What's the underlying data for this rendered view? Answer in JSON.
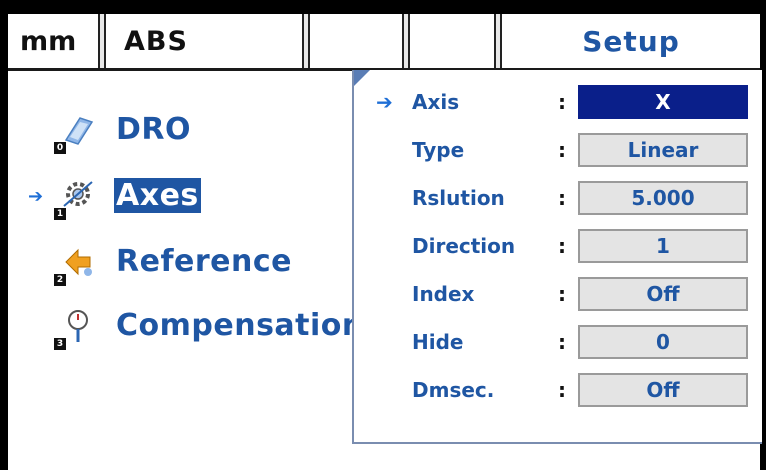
{
  "status_bar": {
    "unit": "mm",
    "mode": "ABS",
    "title": "Setup"
  },
  "menu": {
    "items": [
      {
        "number": "0",
        "label": "DRO",
        "icon": "dro-icon",
        "selected": false
      },
      {
        "number": "1",
        "label": "Axes",
        "icon": "axes-gear-icon",
        "selected": true
      },
      {
        "number": "2",
        "label": "Reference",
        "icon": "reference-icon",
        "selected": false
      },
      {
        "number": "3",
        "label": "Compensation",
        "icon": "compensation-icon",
        "selected": false
      }
    ]
  },
  "settings": {
    "colon": ":",
    "rows": [
      {
        "label": "Axis",
        "value": "X",
        "active": true
      },
      {
        "label": "Type",
        "value": "Linear",
        "active": false
      },
      {
        "label": "Rslution",
        "value": "5.000",
        "active": false
      },
      {
        "label": "Direction",
        "value": "1",
        "active": false
      },
      {
        "label": "Index",
        "value": "Off",
        "active": false
      },
      {
        "label": "Hide",
        "value": "0",
        "active": false
      },
      {
        "label": "Dmsec.",
        "value": "Off",
        "active": false
      }
    ]
  },
  "colors": {
    "accent_blue": "#1f56a3",
    "active_value_bg": "#0a1f8a",
    "value_bg": "#e4e4e4"
  }
}
